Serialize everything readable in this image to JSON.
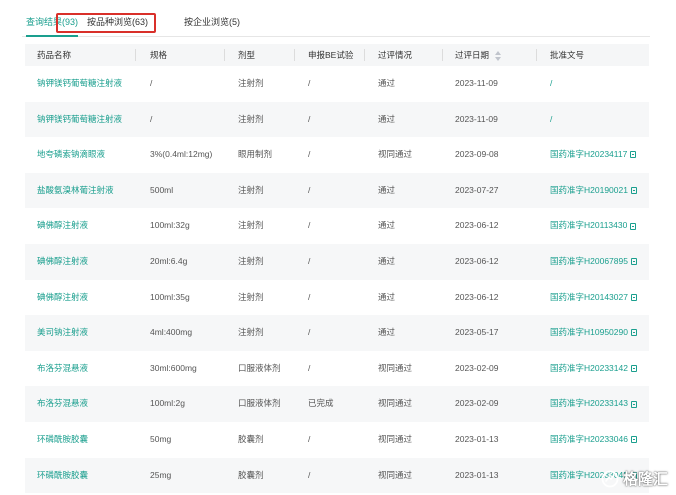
{
  "tabs": [
    {
      "label": "查询结果(93)",
      "active": true
    },
    {
      "label": "按品种浏览(63)",
      "active": false
    },
    {
      "label": "按企业浏览(5)",
      "active": false
    }
  ],
  "table": {
    "headers": [
      "药品名称",
      "规格",
      "剂型",
      "申报BE试验",
      "过评情况",
      "过评日期",
      "批准文号"
    ],
    "rows": [
      {
        "name": "钠钾镁钙葡萄糖注射液",
        "spec": "/",
        "form": "注射剂",
        "be": "/",
        "status": "通过",
        "date": "2023-11-09",
        "approval": "/"
      },
      {
        "name": "钠钾镁钙葡萄糖注射液",
        "spec": "/",
        "form": "注射剂",
        "be": "/",
        "status": "通过",
        "date": "2023-11-09",
        "approval": "/"
      },
      {
        "name": "地夸磷索钠滴眼液",
        "spec": "3%(0.4ml:12mg)",
        "form": "眼用制剂",
        "be": "/",
        "status": "视同通过",
        "date": "2023-09-08",
        "approval": "国药准字H20234117"
      },
      {
        "name": "盐酸氨溴林葡注射液",
        "spec": "500ml",
        "form": "注射剂",
        "be": "/",
        "status": "通过",
        "date": "2023-07-27",
        "approval": "国药准字H20190021"
      },
      {
        "name": "碘佛醇注射液",
        "spec": "100ml:32g",
        "form": "注射剂",
        "be": "/",
        "status": "通过",
        "date": "2023-06-12",
        "approval": "国药准字H20113430"
      },
      {
        "name": "碘佛醇注射液",
        "spec": "20ml:6.4g",
        "form": "注射剂",
        "be": "/",
        "status": "通过",
        "date": "2023-06-12",
        "approval": "国药准字H20067895"
      },
      {
        "name": "碘佛醇注射液",
        "spec": "100ml:35g",
        "form": "注射剂",
        "be": "/",
        "status": "通过",
        "date": "2023-06-12",
        "approval": "国药准字H20143027"
      },
      {
        "name": "美司钠注射液",
        "spec": "4ml:400mg",
        "form": "注射剂",
        "be": "/",
        "status": "通过",
        "date": "2023-05-17",
        "approval": "国药准字H10950290"
      },
      {
        "name": "布洛芬混悬液",
        "spec": "30ml:600mg",
        "form": "口服液体剂",
        "be": "/",
        "status": "视同通过",
        "date": "2023-02-09",
        "approval": "国药准字H20233142"
      },
      {
        "name": "布洛芬混悬液",
        "spec": "100ml:2g",
        "form": "口服液体剂",
        "be": "已完成",
        "status": "视同通过",
        "date": "2023-02-09",
        "approval": "国药准字H20233143"
      },
      {
        "name": "环磷酰胺胶囊",
        "spec": "50mg",
        "form": "胶囊剂",
        "be": "/",
        "status": "视同通过",
        "date": "2023-01-13",
        "approval": "国药准字H20233046"
      },
      {
        "name": "环磷酰胺胶囊",
        "spec": "25mg",
        "form": "胶囊剂",
        "be": "/",
        "status": "视同通过",
        "date": "2023-01-13",
        "approval": "国药准字H20233045"
      }
    ]
  },
  "watermark": {
    "text": "格隆汇"
  },
  "colors": {
    "accent": "#1a9f8e",
    "highlight_box": "#d9302a",
    "header_bg": "#f5f6f7",
    "row_alt_bg": "#f6f7f8"
  },
  "icons": {
    "sort": "sort-icon",
    "document": "document-icon",
    "watermark_logo": "gelonghui-logo-icon"
  }
}
